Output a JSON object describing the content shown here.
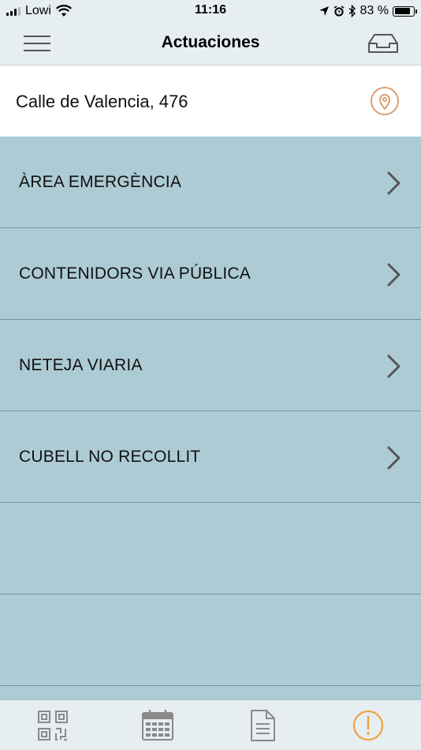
{
  "status_bar": {
    "carrier": "Lowi",
    "time": "11:16",
    "battery": "83 %",
    "battery_level": 0.83,
    "icons": [
      "signal-icon",
      "wifi-icon",
      "location-arrow-icon",
      "alarm-icon",
      "bluetooth-icon",
      "battery-icon"
    ]
  },
  "header": {
    "title": "Actuaciones",
    "left_icon": "menu-icon",
    "right_icon": "inbox-icon"
  },
  "address": {
    "text": "Calle de Valencia, 476",
    "icon": "location-pin-icon"
  },
  "list": {
    "items": [
      {
        "label": "ÀREA EMERGÈNCIA"
      },
      {
        "label": "CONTENIDORS VIA PÚBLICA"
      },
      {
        "label": "NETEJA VIARIA"
      },
      {
        "label": "CUBELL NO RECOLLIT"
      }
    ]
  },
  "tab_bar": {
    "tabs": [
      {
        "name": "qr-code-icon",
        "active": false
      },
      {
        "name": "calendar-icon",
        "active": false
      },
      {
        "name": "document-icon",
        "active": false
      },
      {
        "name": "alert-icon",
        "active": true
      }
    ]
  },
  "colors": {
    "accent": "#f0a23c",
    "pin": "#d79563",
    "list_background": "#adcbd4",
    "bar_background": "#e6eef1",
    "icon_gray": "#8a8a8a"
  }
}
